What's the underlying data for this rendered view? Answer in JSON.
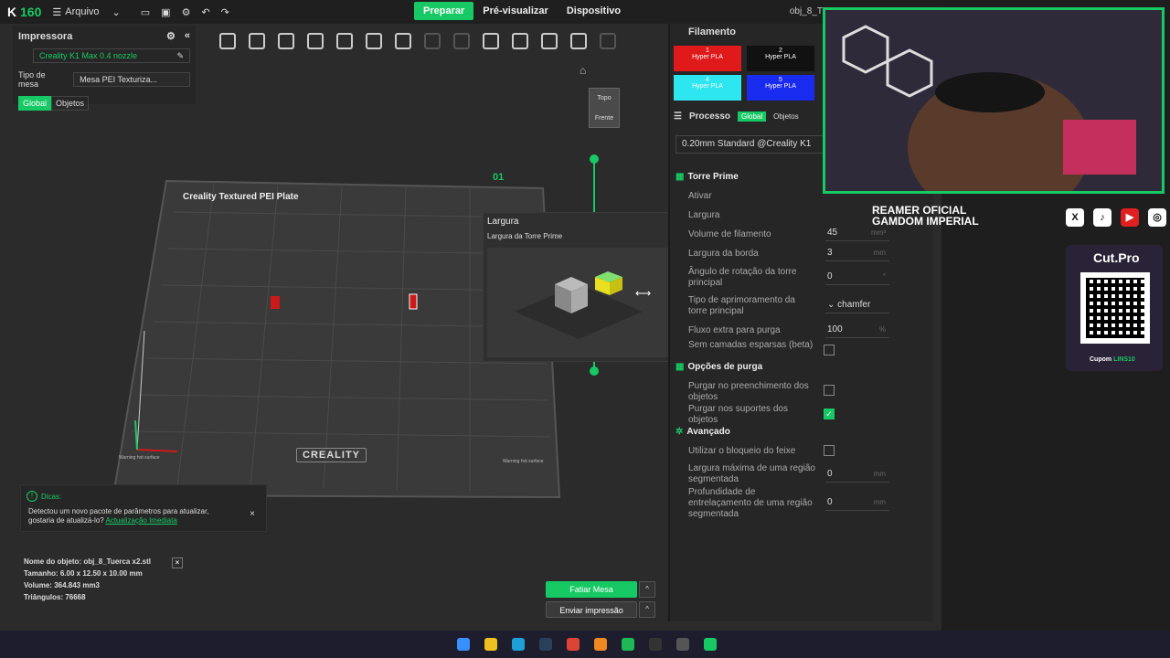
{
  "titlebar": {
    "logo": "K",
    "logo_num": "160",
    "menu_label": "Arquivo",
    "tabs": [
      "Preparar",
      "Pré-visualizar",
      "Dispositivo"
    ],
    "filename": "obj_8_T"
  },
  "printer_panel": {
    "title": "Impressora",
    "printer": "Creality K1 Max 0.4 nozzle",
    "bed_label": "Tipo de mesa",
    "bed_value": "Mesa PEI Texturiza...",
    "toggle": [
      "Global",
      "Objetos"
    ]
  },
  "viewport": {
    "plate_label": "Creality Textured PEI Plate",
    "plate_number": "01",
    "brand": "CREALITY",
    "warning_left": "Warning hot surface",
    "warning_right": "Warning hot surface",
    "cube_top": "Topo",
    "cube_front": "Frente"
  },
  "tooltip": {
    "title": "Largura",
    "subtitle": "Largura da Torre Prime"
  },
  "tips": {
    "title": "Dicas:",
    "body": "Detectou um novo pacote de parâmetros para atualizar, gostaria de atualizá-lo?",
    "link": "Actualização Imediata",
    "close": "×"
  },
  "object_info": {
    "name": "Nome do objeto: obj_8_Tuerca x2.stl",
    "size": "Tamanho: 6.00 x 12.50 x 10.00 mm",
    "volume": "Volume: 364.843 mm3",
    "triangles": "Triângulos: 76668",
    "close": "×"
  },
  "actions": {
    "slice": "Fatiar Mesa",
    "send": "Enviar impressão",
    "chevron": "^"
  },
  "filament": {
    "title": "Filamento",
    "items": [
      {
        "num": "1",
        "name": "Hyper PLA",
        "color": "#e01a1a"
      },
      {
        "num": "2",
        "name": "Hyper PLA",
        "color": "#111111"
      },
      {
        "num": "4",
        "name": "Hyper PLA",
        "color": "#2ee6f0"
      },
      {
        "num": "5",
        "name": "Hyper PLA",
        "color": "#1a2bf0"
      }
    ]
  },
  "process": {
    "title": "Processo",
    "toggle_on": "Global",
    "toggle_off": "Objetos",
    "preset": "0.20mm Standard @Creality K1"
  },
  "sections": {
    "prime_tower": "Torre Prime",
    "purge": "Opções de purga",
    "advanced": "Avançado"
  },
  "params": {
    "enable": "Ativar",
    "width": "Largura",
    "filament_volume": "Volume de filamento",
    "filament_volume_value": "45",
    "filament_volume_unit": "mm³",
    "brim_width": "Largura da borda",
    "brim_width_value": "3",
    "brim_width_unit": "mm",
    "rotation": "Ângulo de rotação da torre principal",
    "rotation_value": "0",
    "rotation_unit": "°",
    "enhance": "Tipo de aprimoramento da torre principal",
    "enhance_value": "chamfer",
    "extra_flow": "Fluxo extra para purga",
    "extra_flow_value": "100",
    "extra_flow_unit": "%",
    "sparse": "Sem camadas esparsas (beta)",
    "purge_infill": "Purgar no preenchimento dos objetos",
    "purge_support": "Purgar nos suportes dos objetos",
    "lock": "Utilizar o bloqueio do feixe",
    "max_width": "Largura máxima de uma região segmentada",
    "max_width_value": "0",
    "max_width_unit": "mm",
    "depth": "Profundidade de entrelaçamento de uma região segmentada",
    "depth_value": "0",
    "depth_unit": "mm"
  },
  "overlay": {
    "banner_line1": "REAMER OFICIAL",
    "banner_line2": "GAMDOM IMPERIAL",
    "social": [
      "X",
      "♪",
      "▶",
      "◎"
    ],
    "cutpro_title": "Cut.Pro",
    "coupon_label": "Cupom",
    "coupon_code": "LINS10"
  }
}
